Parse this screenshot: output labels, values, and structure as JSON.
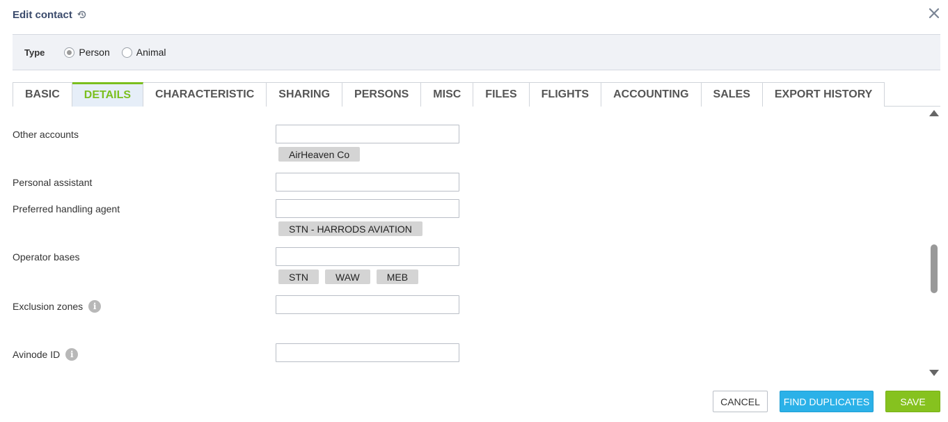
{
  "header": {
    "title": "Edit contact",
    "history_icon": "history-icon",
    "close_icon": "close-icon"
  },
  "type": {
    "label": "Type",
    "options": [
      {
        "label": "Person",
        "checked": true
      },
      {
        "label": "Animal",
        "checked": false
      }
    ]
  },
  "tabs": [
    {
      "label": "BASIC",
      "active": false
    },
    {
      "label": "DETAILS",
      "active": true
    },
    {
      "label": "CHARACTERISTIC",
      "active": false
    },
    {
      "label": "SHARING",
      "active": false
    },
    {
      "label": "PERSONS",
      "active": false
    },
    {
      "label": "MISC",
      "active": false
    },
    {
      "label": "FILES",
      "active": false
    },
    {
      "label": "FLIGHTS",
      "active": false
    },
    {
      "label": "ACCOUNTING",
      "active": false
    },
    {
      "label": "SALES",
      "active": false
    },
    {
      "label": "EXPORT HISTORY",
      "active": false
    }
  ],
  "fields": {
    "other_accounts": {
      "label": "Other accounts",
      "value": "",
      "tags": [
        "AirHeaven Co"
      ]
    },
    "personal_assistant": {
      "label": "Personal assistant",
      "value": ""
    },
    "preferred_handling_agent": {
      "label": "Preferred handling agent",
      "value": "",
      "tags": [
        "STN - HARRODS AVIATION"
      ]
    },
    "operator_bases": {
      "label": "Operator bases",
      "value": "",
      "tags": [
        "STN",
        "WAW",
        "MEB"
      ]
    },
    "exclusion_zones": {
      "label": "Exclusion zones",
      "value": "",
      "info_icon": "i"
    },
    "avinode_id": {
      "label": "Avinode ID",
      "value": "",
      "info_icon": "i"
    }
  },
  "footer": {
    "cancel": "CANCEL",
    "find_duplicates": "FIND DUPLICATES",
    "save": "SAVE"
  },
  "colors": {
    "accent_green": "#86c21f",
    "accent_blue": "#2bb1e8",
    "title": "#3a4a6b"
  }
}
